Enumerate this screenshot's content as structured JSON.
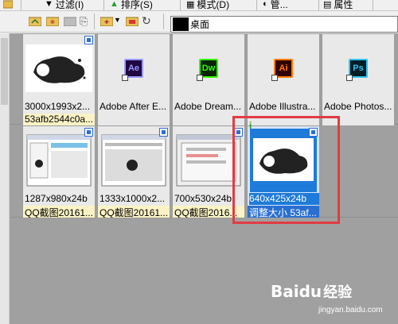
{
  "toolbar": {
    "filter_label": "过滤(I)",
    "sort_label": "排序(S)",
    "mode_label": "模式(D)",
    "manage_label": "管...",
    "properties_label": "属性"
  },
  "path_bar": {
    "text": "桌面"
  },
  "tiles_row1": [
    {
      "line1": "3000x1993x2...",
      "line2": "53afb2544c0a...",
      "kind": "image-fist"
    },
    {
      "line1": "Adobe After E...",
      "line2": "",
      "kind": "app",
      "icon_text": "Ae",
      "icon_color": "#9999ff",
      "icon_bg": "#1f0740"
    },
    {
      "line1": "Adobe Dream...",
      "line2": "",
      "kind": "app",
      "icon_text": "Dw",
      "icon_color": "#35fa00",
      "icon_bg": "#072401"
    },
    {
      "line1": "Adobe Illustra...",
      "line2": "",
      "kind": "app",
      "icon_text": "Ai",
      "icon_color": "#ff7c00",
      "icon_bg": "#330000"
    },
    {
      "line1": "Adobe Photos...",
      "line2": "",
      "kind": "app",
      "icon_text": "Ps",
      "icon_color": "#31c5f0",
      "icon_bg": "#001d26"
    }
  ],
  "tiles_row2": [
    {
      "line1": "1287x980x24b",
      "line2": "QQ截图20161...",
      "kind": "screenshot"
    },
    {
      "line1": "1333x1000x2...",
      "line2": "QQ截图20161...",
      "kind": "screenshot"
    },
    {
      "line1": "700x530x24b",
      "line2": "QQ截图2016...",
      "kind": "screenshot"
    },
    {
      "line1": "640x425x24b",
      "line2": "调整大小 53af...",
      "kind": "image-fist",
      "selected": true
    }
  ],
  "watermark": {
    "logo": "Baidu",
    "cn": "经验",
    "url": "jingyan.baidu.com"
  },
  "colors": {
    "highlight_box": "#e23b43",
    "selection_blue": "#1e7bd9",
    "label_yellow": "#fbf3c5"
  }
}
